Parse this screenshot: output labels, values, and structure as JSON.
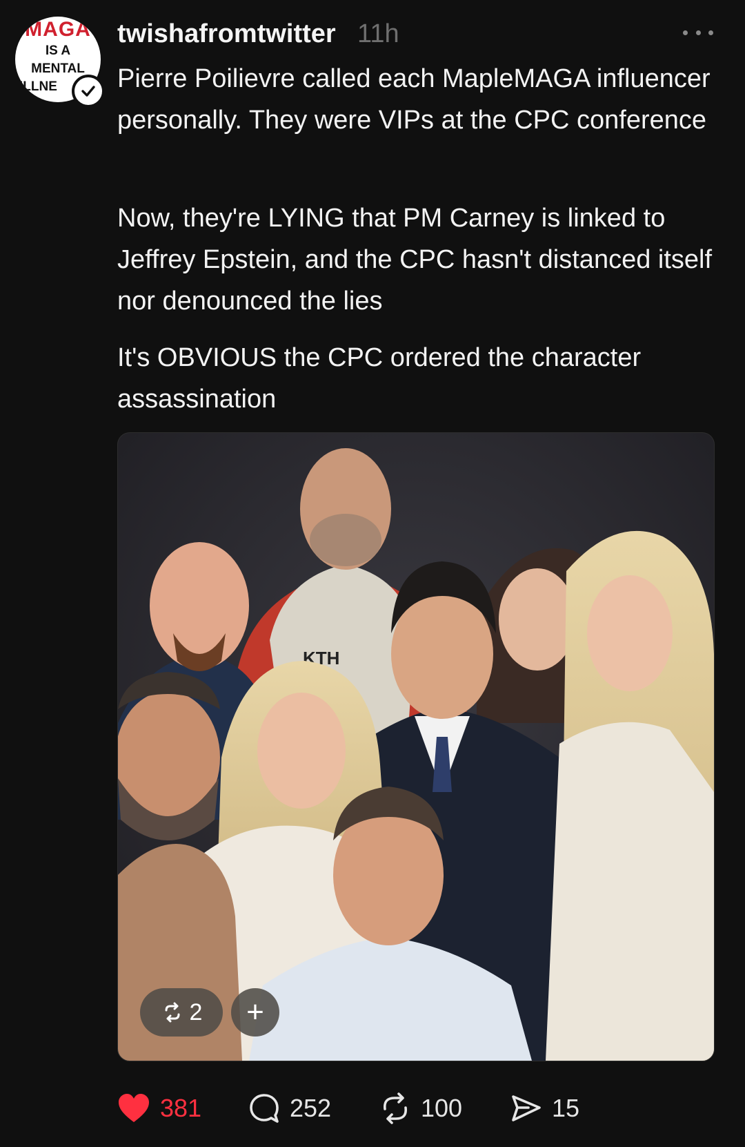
{
  "post": {
    "avatar_text": {
      "line1": "MAGA",
      "line2": "IS A",
      "line3": "MENTAL",
      "line4": "ILLNE"
    },
    "username": "twishafromtwitter",
    "time": "11h",
    "paragraphs": [
      "Pierre Poilievre called each MapleMAGA influencer personally. They were VIPs at the CPC conference",
      "Now, they're LYING that PM Carney is linked to Jeffrey Epstein, and the CPC hasn't distanced itself nor denounced the lies",
      "It's OBVIOUS the CPC ordered the character assassination"
    ],
    "photo": {
      "repost_count": "2",
      "add_label": "+",
      "hoodie_text": "KTH"
    },
    "actions": {
      "likes": "381",
      "comments": "252",
      "reposts": "100",
      "shares": "15"
    }
  },
  "colors": {
    "background": "#101010",
    "like": "#ff3040",
    "muted": "#6f6f6f"
  },
  "icons": [
    "verified-check-icon",
    "more-icon",
    "repost-icon",
    "plus-icon",
    "heart-icon",
    "comment-icon",
    "share-icon"
  ]
}
